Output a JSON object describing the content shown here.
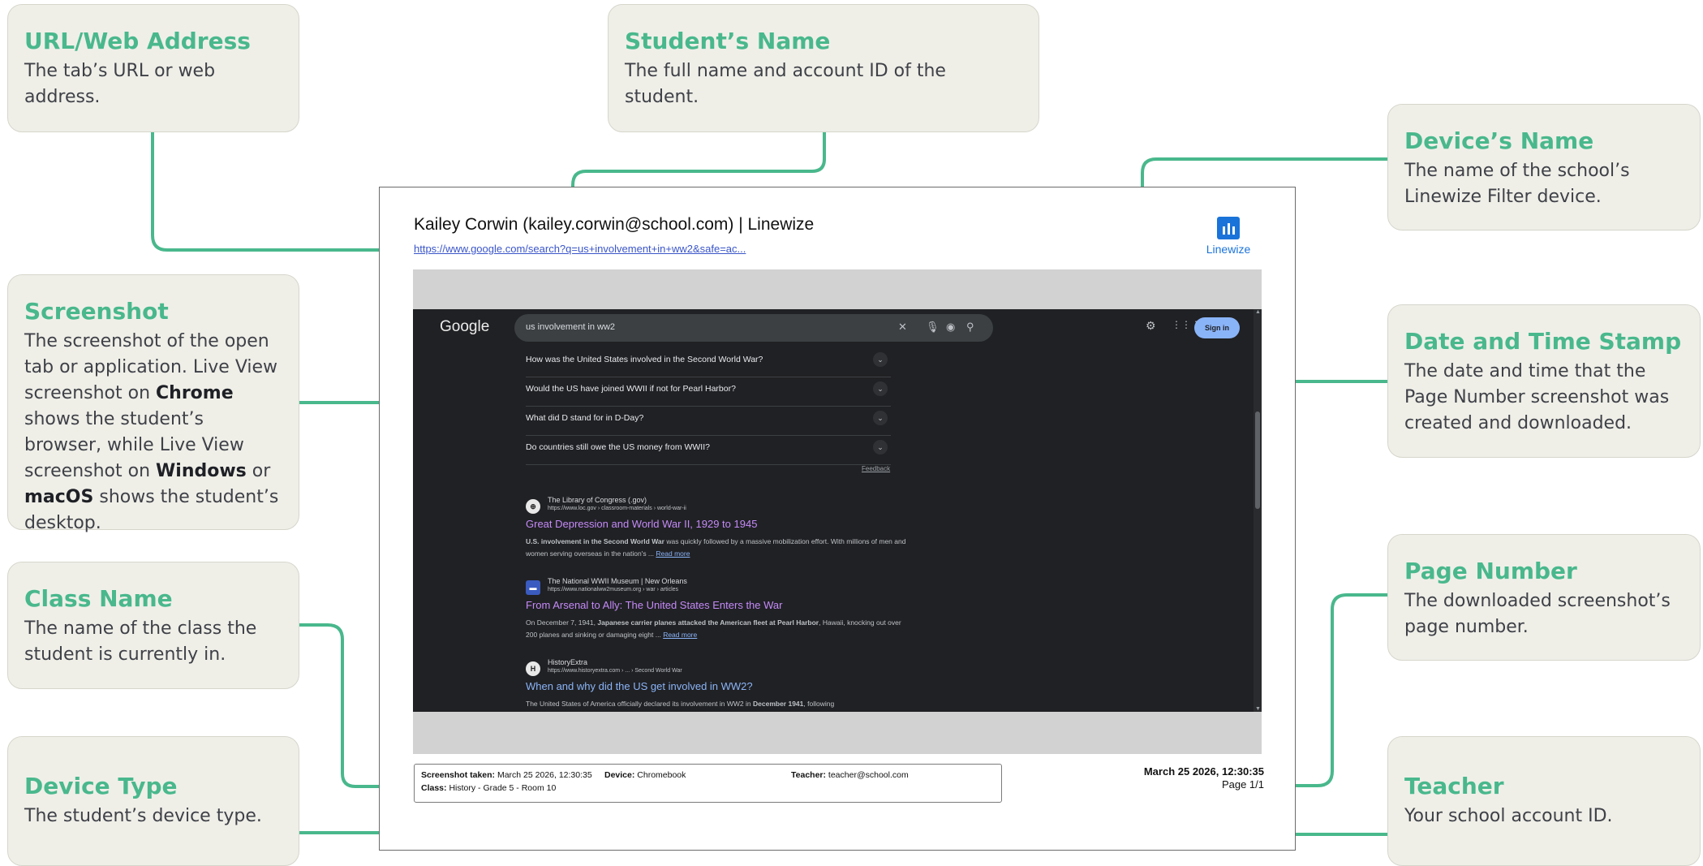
{
  "callouts": {
    "url": {
      "title": "URL/Web Address",
      "desc": "The tab’s URL or web address."
    },
    "student_name": {
      "title": "Student’s Name",
      "desc": "The full name and account ID of the student."
    },
    "device_name": {
      "title": "Device’s Name",
      "desc": "The name of the school’s Linewize Filter device."
    },
    "screenshot": {
      "title": "Screenshot",
      "desc_html": "The screenshot of the open tab or application. Live View screenshot on <b>Chrome</b> shows the student’s browser, while Live View screenshot on <b>Windows</b> or <b>macOS</b> shows the student’s desktop."
    },
    "date_time": {
      "title": "Date and Time Stamp",
      "desc": "The date and time that the Page Number screenshot was created and downloaded."
    },
    "class_name": {
      "title": "Class Name",
      "desc": "The name of the class the student is currently in."
    },
    "page_number": {
      "title": "Page Number",
      "desc": "The downloaded screenshot’s page number."
    },
    "device_type": {
      "title": "Device Type",
      "desc": "The student’s device type."
    },
    "teacher": {
      "title": "Teacher",
      "desc": "Your school account ID."
    }
  },
  "document": {
    "title": "Kailey Corwin (kailey.corwin@school.com) | Linewize",
    "url": "https://www.google.com/search?q=us+involvement+in+ww2&safe=ac...",
    "brand": "Linewize",
    "footer": {
      "screenshot_taken_label": "Screenshot taken:",
      "screenshot_taken_value": "March 25 2026, 12:30:35",
      "device_label": "Device:",
      "device_value": "Chromebook",
      "teacher_label": "Teacher:",
      "teacher_value": "teacher@school.com",
      "class_label": "Class:",
      "class_value": "History - Grade 5 - Room 10"
    },
    "stamp_datetime": "March 25 2026, 12:30:35",
    "page": "Page 1/1"
  },
  "google": {
    "logo": "Google",
    "query": "us involvement in ww2",
    "sign_in": "Sign in",
    "feedback": "Feedback",
    "questions": [
      "How was the United States involved in the Second World War?",
      "Would the US have joined WWII if not for Pearl Harbor?",
      "What did D stand for in D-Day?",
      "Do countries still owe the US money from WWII?"
    ],
    "results": [
      {
        "site": "The Library of Congress (.gov)",
        "cite": "https://www.loc.gov › classroom-materials › world-war-ii",
        "title": "Great Depression and World War II, 1929 to 1945",
        "snippet_bold": "U.S. involvement in the Second World War",
        "snippet": " was quickly followed by a massive mobilization effort. With millions of men and women serving overseas in the nation's ...",
        "read_more": "Read more"
      },
      {
        "site": "The National WWII Museum | New Orleans",
        "cite": "https://www.nationalww2museum.org › war › articles",
        "title": "From Arsenal to Ally: The United States Enters the War",
        "snippet_pre": "On December 7, 1941, ",
        "snippet_bold": "Japanese carrier planes attacked the American fleet at Pearl Harbor",
        "snippet": ", Hawaii, knocking out over 200 planes and sinking or damaging eight ...",
        "read_more": "Read more"
      },
      {
        "site": "HistoryExtra",
        "cite": "https://www.historyextra.com › ... › Second World War",
        "title": "When and why did the US get involved in WW2?",
        "snippet_pre": "The United States of America officially declared its involvement in WW2 in ",
        "snippet_bold": "December 1941",
        "snippet": ", following"
      }
    ]
  },
  "colors": {
    "accent": "#49b88c",
    "callout_bg": "#efefe8",
    "title_green": "#49b88c"
  }
}
